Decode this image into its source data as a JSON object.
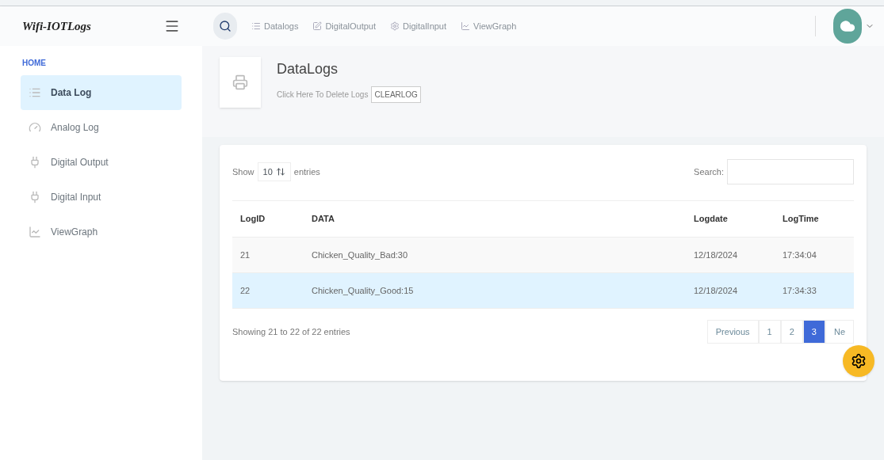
{
  "brand": "Wifi-IOTLogs",
  "topnav": [
    {
      "label": "Datalogs"
    },
    {
      "label": "DigitalOutput"
    },
    {
      "label": "DigitalInput"
    },
    {
      "label": "ViewGraph"
    }
  ],
  "sidebar": {
    "heading": "HOME",
    "items": [
      {
        "label": "Data Log",
        "selected": true
      },
      {
        "label": "Analog Log",
        "selected": false
      },
      {
        "label": "Digital Output",
        "selected": false
      },
      {
        "label": "Digital Input",
        "selected": false
      },
      {
        "label": "ViewGraph",
        "selected": false
      }
    ]
  },
  "page_header": {
    "title": "DataLogs",
    "subtitle": "Click Here To Delete Logs",
    "button": "CLEARLOG"
  },
  "table": {
    "show_label": "Show",
    "page_size": "10",
    "entries_label": "entries",
    "search_label": "Search:",
    "columns": [
      "LogID",
      "DATA",
      "Logdate",
      "LogTime"
    ],
    "rows": [
      {
        "cells": [
          "21",
          "Chicken_Quality_Bad:30",
          "12/18/2024",
          "17:34:04"
        ],
        "selected": false
      },
      {
        "cells": [
          "22",
          "Chicken_Quality_Good:15",
          "12/18/2024",
          "17:34:33"
        ],
        "selected": true
      }
    ],
    "info": "Showing 21 to 22 of 22 entries",
    "pagination": [
      {
        "label": "Previous",
        "selected": false
      },
      {
        "label": "1",
        "selected": false
      },
      {
        "label": "2",
        "selected": false
      },
      {
        "label": "3",
        "selected": true
      },
      {
        "label": "Ne",
        "selected": false
      }
    ]
  }
}
